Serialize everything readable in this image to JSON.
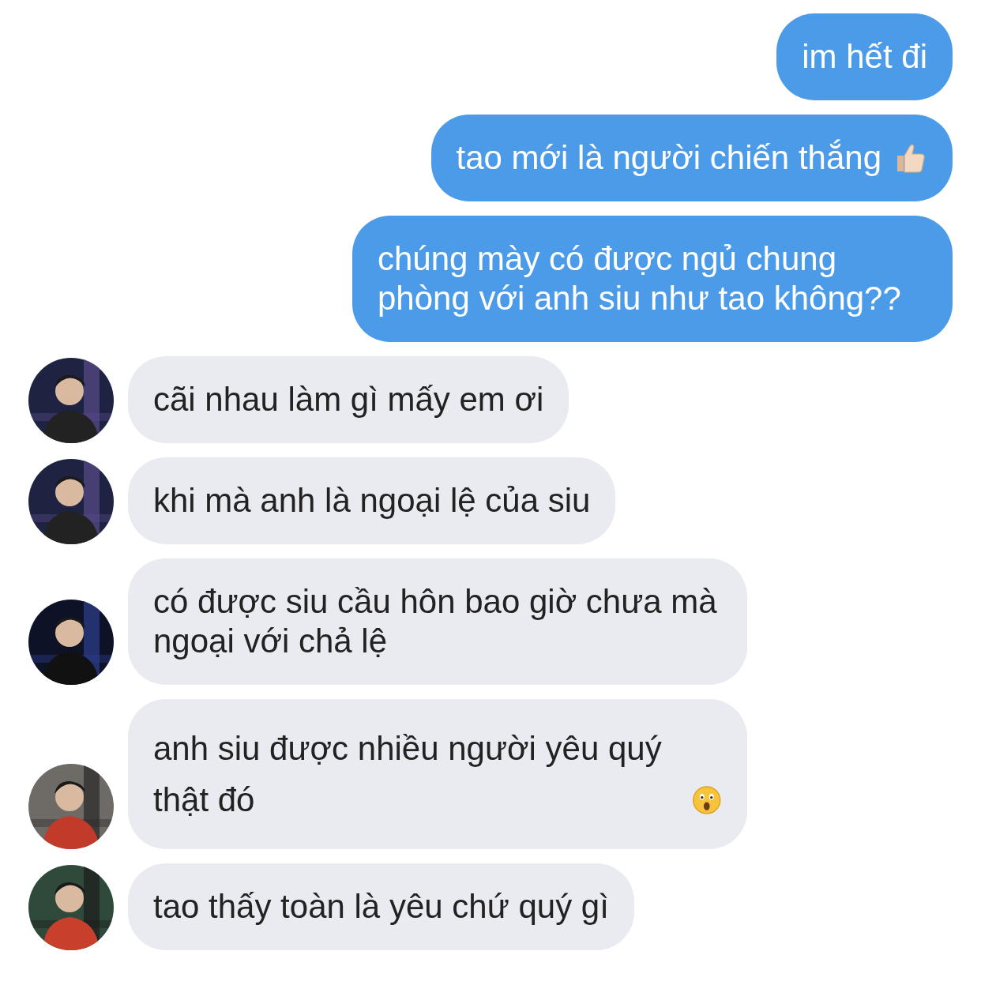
{
  "messages": [
    {
      "outgoing": true,
      "text": "im hết đi"
    },
    {
      "outgoing": true,
      "text": "tao mới là người chiến thắng",
      "emoji": {
        "kind": "thumbs-up"
      }
    },
    {
      "outgoing": true,
      "text": "chúng mày có được ngủ chung phòng với anh siu như tao không??"
    },
    {
      "outgoing": false,
      "text": "cãi nhau làm gì mấy em ơi"
    },
    {
      "outgoing": false,
      "text": "khi mà anh là ngoại lệ của siu"
    },
    {
      "outgoing": false,
      "text": "có được siu cầu hôn bao giờ chưa mà ngoại với chả lệ"
    },
    {
      "outgoing": false,
      "text": "anh siu được nhiều người yêu quý thật đó",
      "emoji": {
        "kind": "astonished"
      }
    },
    {
      "outgoing": false,
      "text": "tao thấy toàn là yêu chứ quý gì"
    }
  ]
}
